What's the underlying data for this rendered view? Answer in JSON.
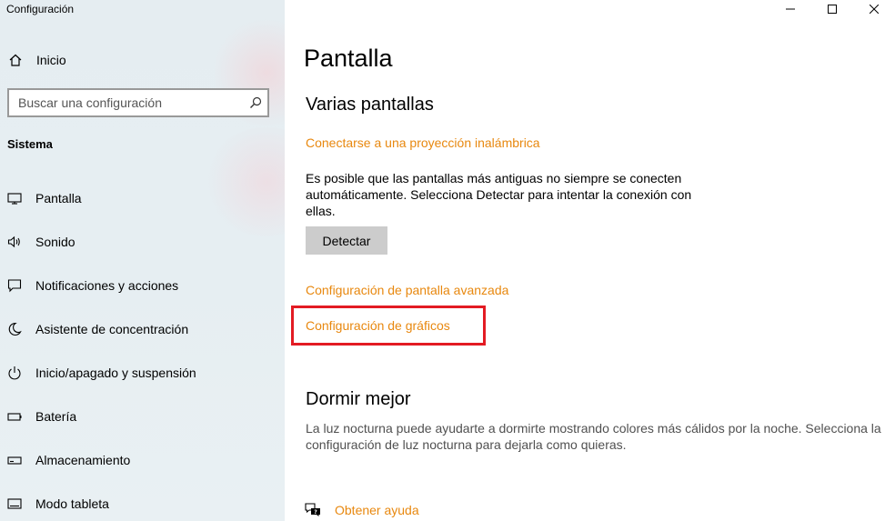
{
  "window": {
    "title": "Configuración"
  },
  "sidebar": {
    "home_label": "Inicio",
    "search_placeholder": "Buscar una configuración",
    "section_title": "Sistema",
    "items": [
      {
        "label": "Pantalla",
        "icon": "monitor-icon"
      },
      {
        "label": "Sonido",
        "icon": "speaker-icon"
      },
      {
        "label": "Notificaciones y acciones",
        "icon": "notification-icon"
      },
      {
        "label": "Asistente de concentración",
        "icon": "moon-icon"
      },
      {
        "label": "Inicio/apagado y suspensión",
        "icon": "power-icon"
      },
      {
        "label": "Batería",
        "icon": "battery-icon"
      },
      {
        "label": "Almacenamiento",
        "icon": "storage-icon"
      },
      {
        "label": "Modo tableta",
        "icon": "tablet-icon"
      }
    ]
  },
  "main": {
    "page_title": "Pantalla",
    "multi_display": {
      "heading": "Varias pantallas",
      "wireless_link": "Conectarse a una proyección inalámbrica",
      "description": "Es posible que las pantallas más antiguas no siempre se conecten automáticamente. Selecciona Detectar para intentar la conexión con ellas.",
      "detect_button": "Detectar",
      "advanced_link": "Configuración de pantalla avanzada",
      "graphics_link": "Configuración de gráficos"
    },
    "sleep_better": {
      "heading": "Dormir mejor",
      "description": "La luz nocturna puede ayudarte a dormirte mostrando colores más cálidos por la noche. Selecciona la configuración de luz nocturna para dejarla como quieras."
    },
    "help_link": "Obtener ayuda"
  },
  "colors": {
    "accent_link": "#e8880f",
    "highlight_border": "#e31b23",
    "sidebar_bg": "#e6eef2"
  }
}
